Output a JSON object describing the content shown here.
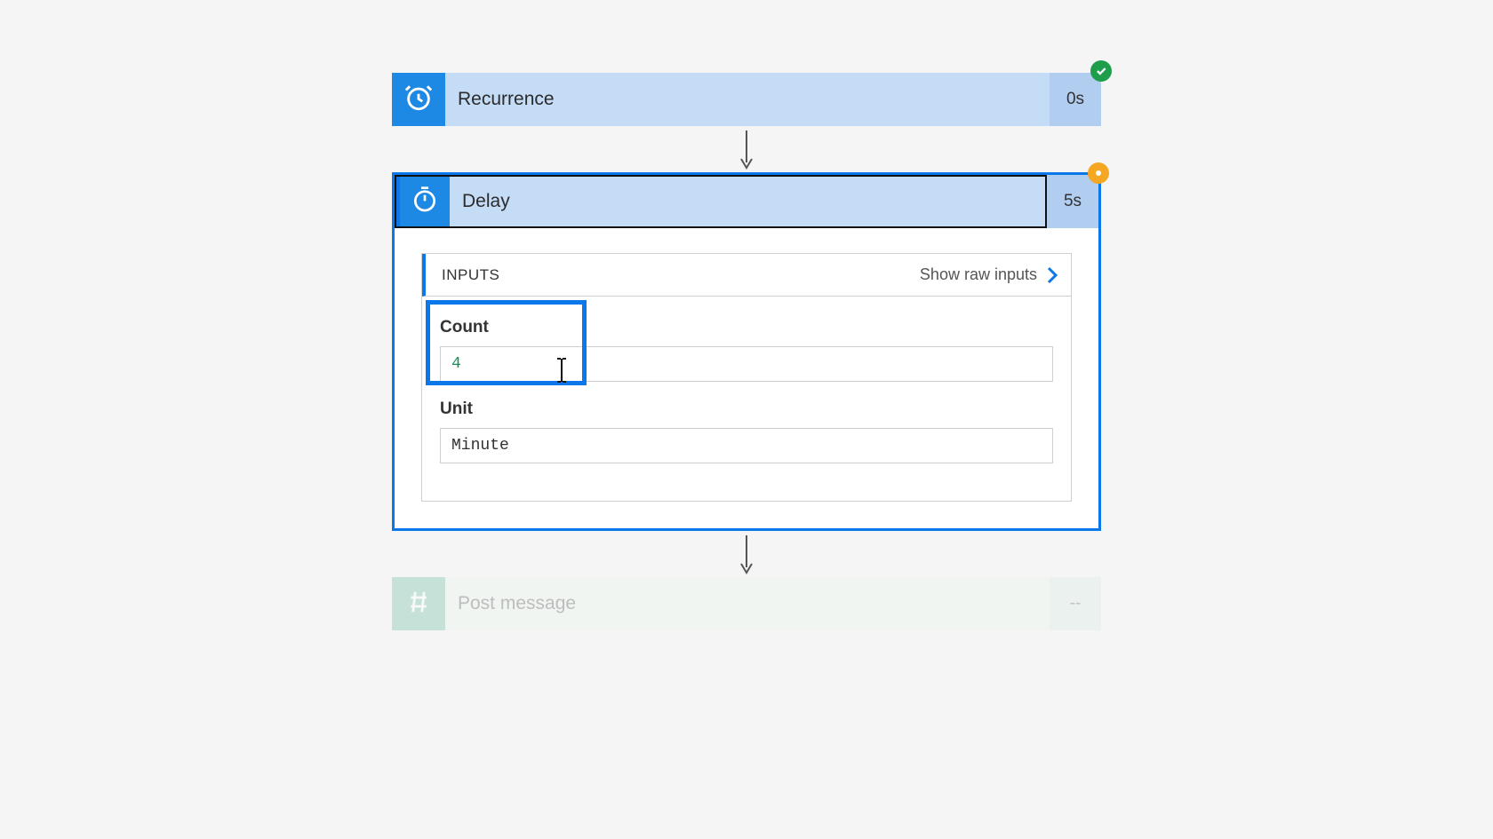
{
  "steps": {
    "recurrence": {
      "title": "Recurrence",
      "time": "0s",
      "status": "success"
    },
    "delay": {
      "title": "Delay",
      "time": "5s",
      "status": "warning",
      "inputs_label": "INPUTS",
      "show_raw_label": "Show raw inputs",
      "fields": {
        "count": {
          "label": "Count",
          "value": "4"
        },
        "unit": {
          "label": "Unit",
          "value": "Minute"
        }
      }
    },
    "post_message": {
      "title": "Post message",
      "time": "--"
    }
  },
  "colors": {
    "accent": "#0b77e8",
    "icon_bg": "#1e88e5",
    "success": "#1e9e4a",
    "warning": "#f5a623"
  }
}
